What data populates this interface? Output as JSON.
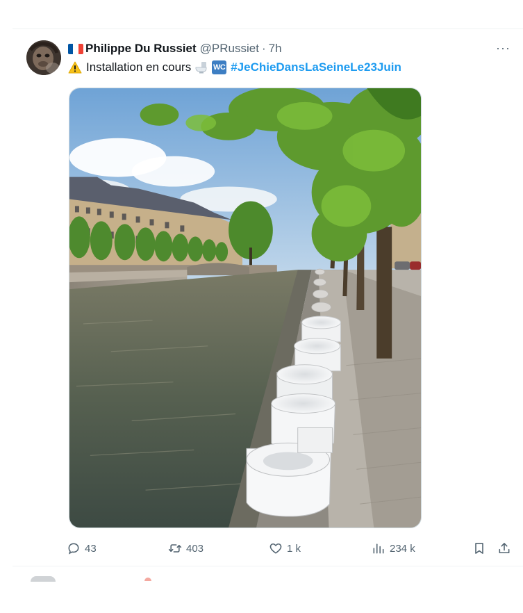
{
  "tweet": {
    "author": {
      "display_name": "Philippe Du Russiet",
      "handle": "@PRussiet",
      "separator": "·",
      "time": "7h"
    },
    "text": {
      "prefix": "Installation en cours",
      "hashtag": "#JeChieDansLaSeineLe23Juin",
      "emoji_wc_label": "WC"
    },
    "more_label": "···",
    "actions": {
      "replies": "43",
      "retweets": "403",
      "likes": "1 k",
      "views": "234 k"
    }
  },
  "icons": {
    "flag": "france-flag-icon",
    "warning": "warning-icon",
    "toilet": "toilet-icon",
    "wc": "wc-icon",
    "reply": "reply-icon",
    "retweet": "retweet-icon",
    "like": "heart-icon",
    "views": "views-chart-icon",
    "bookmark": "bookmark-icon",
    "share": "share-icon"
  },
  "colors": {
    "link": "#1d9bf0",
    "muted": "#536471",
    "text": "#0f1419",
    "flag_blue": "#0055a4",
    "flag_white": "#ffffff",
    "flag_red": "#ef4135"
  }
}
